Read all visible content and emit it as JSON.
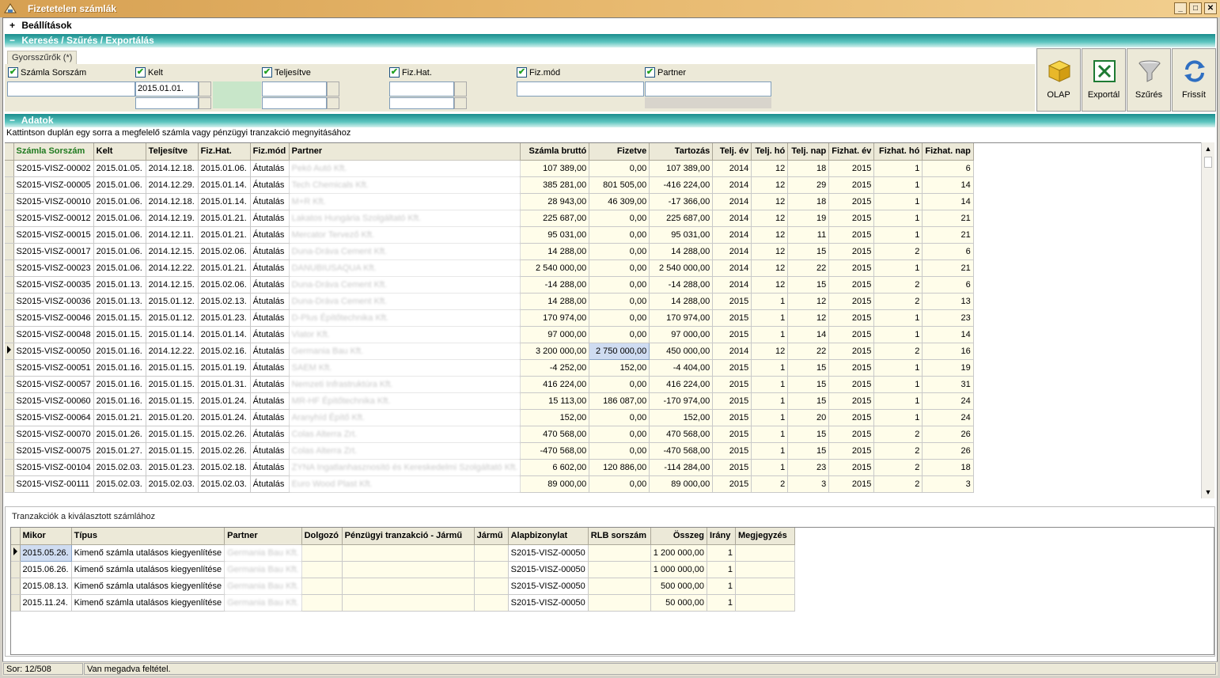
{
  "window": {
    "title": "Fizetetelen számlák",
    "controls": [
      "_",
      "□",
      "✕"
    ]
  },
  "sections": {
    "settings": "Beállítások",
    "search": "Keresés / Szűrés / Exportálás",
    "data": "Adatok",
    "settings_sign": "+",
    "search_sign": "−",
    "data_sign": "−"
  },
  "quick_filters_tab": "Gyorsszűrők (*)",
  "filters": [
    {
      "label": "Számla Sorszám",
      "value": ""
    },
    {
      "label": "Kelt",
      "value": "2015.01.01."
    },
    {
      "label": "Teljesítve",
      "value": ""
    },
    {
      "label": "Fiz.Hat.",
      "value": ""
    },
    {
      "label": "Fiz.mód",
      "value": ""
    },
    {
      "label": "Partner",
      "value": ""
    }
  ],
  "toolbar": [
    {
      "label": "OLAP",
      "icon": "olap-cube-icon"
    },
    {
      "label": "Exportál",
      "icon": "excel-export-icon"
    },
    {
      "label": "Szűrés",
      "icon": "filter-funnel-icon"
    },
    {
      "label": "Frissít",
      "icon": "refresh-icon"
    }
  ],
  "hint": "Kattintson duplán egy sorra a megfelelő számla vagy pénzügyi tranzakció megnyitásához",
  "grid": {
    "columns": [
      "Számla Sorszám",
      "Kelt",
      "Teljesítve",
      "Fiz.Hat.",
      "Fiz.mód",
      "Partner",
      "Számla bruttó",
      "Fizetve",
      "Tartozás",
      "Telj. év",
      "Telj. hó",
      "Telj. nap",
      "Fizhat. év",
      "Fizhat. hó",
      "Fizhat. nap"
    ],
    "rows": [
      [
        "S2015-VISZ-00002",
        "2015.01.05.",
        "2014.12.18.",
        "2015.01.06.",
        "Átutalás",
        "Pekó Autó Kft.",
        "107 389,00",
        "0,00",
        "107 389,00",
        "2014",
        "12",
        "18",
        "2015",
        "1",
        "6"
      ],
      [
        "S2015-VISZ-00005",
        "2015.01.06.",
        "2014.12.29.",
        "2015.01.14.",
        "Átutalás",
        "Tech Chemicals Kft.",
        "385 281,00",
        "801 505,00",
        "-416 224,00",
        "2014",
        "12",
        "29",
        "2015",
        "1",
        "14"
      ],
      [
        "S2015-VISZ-00010",
        "2015.01.06.",
        "2014.12.18.",
        "2015.01.14.",
        "Átutalás",
        "M+R Kft.",
        "28 943,00",
        "46 309,00",
        "-17 366,00",
        "2014",
        "12",
        "18",
        "2015",
        "1",
        "14"
      ],
      [
        "S2015-VISZ-00012",
        "2015.01.06.",
        "2014.12.19.",
        "2015.01.21.",
        "Átutalás",
        "Lakatos Hungária Szolgáltató Kft.",
        "225 687,00",
        "0,00",
        "225 687,00",
        "2014",
        "12",
        "19",
        "2015",
        "1",
        "21"
      ],
      [
        "S2015-VISZ-00015",
        "2015.01.06.",
        "2014.12.11.",
        "2015.01.21.",
        "Átutalás",
        "Mercator Tervező Kft.",
        "95 031,00",
        "0,00",
        "95 031,00",
        "2014",
        "12",
        "11",
        "2015",
        "1",
        "21"
      ],
      [
        "S2015-VISZ-00017",
        "2015.01.06.",
        "2014.12.15.",
        "2015.02.06.",
        "Átutalás",
        "Duna-Dráva Cement Kft.",
        "14 288,00",
        "0,00",
        "14 288,00",
        "2014",
        "12",
        "15",
        "2015",
        "2",
        "6"
      ],
      [
        "S2015-VISZ-00023",
        "2015.01.06.",
        "2014.12.22.",
        "2015.01.21.",
        "Átutalás",
        "DANUBIUSAQUA Kft.",
        "2 540 000,00",
        "0,00",
        "2 540 000,00",
        "2014",
        "12",
        "22",
        "2015",
        "1",
        "21"
      ],
      [
        "S2015-VISZ-00035",
        "2015.01.13.",
        "2014.12.15.",
        "2015.02.06.",
        "Átutalás",
        "Duna-Dráva Cement Kft.",
        "-14 288,00",
        "0,00",
        "-14 288,00",
        "2014",
        "12",
        "15",
        "2015",
        "2",
        "6"
      ],
      [
        "S2015-VISZ-00036",
        "2015.01.13.",
        "2015.01.12.",
        "2015.02.13.",
        "Átutalás",
        "Duna-Dráva Cement Kft.",
        "14 288,00",
        "0,00",
        "14 288,00",
        "2015",
        "1",
        "12",
        "2015",
        "2",
        "13"
      ],
      [
        "S2015-VISZ-00046",
        "2015.01.15.",
        "2015.01.12.",
        "2015.01.23.",
        "Átutalás",
        "D-Plus Építőtechnika Kft.",
        "170 974,00",
        "0,00",
        "170 974,00",
        "2015",
        "1",
        "12",
        "2015",
        "1",
        "23"
      ],
      [
        "S2015-VISZ-00048",
        "2015.01.15.",
        "2015.01.14.",
        "2015.01.14.",
        "Átutalás",
        "Viator Kft.",
        "97 000,00",
        "0,00",
        "97 000,00",
        "2015",
        "1",
        "14",
        "2015",
        "1",
        "14"
      ],
      [
        "S2015-VISZ-00050",
        "2015.01.16.",
        "2014.12.22.",
        "2015.02.16.",
        "Átutalás",
        "Germania Bau Kft.",
        "3 200 000,00",
        "2 750 000,00",
        "450 000,00",
        "2014",
        "12",
        "22",
        "2015",
        "2",
        "16"
      ],
      [
        "S2015-VISZ-00051",
        "2015.01.16.",
        "2015.01.15.",
        "2015.01.19.",
        "Átutalás",
        "SAEM Kft.",
        "-4 252,00",
        "152,00",
        "-4 404,00",
        "2015",
        "1",
        "15",
        "2015",
        "1",
        "19"
      ],
      [
        "S2015-VISZ-00057",
        "2015.01.16.",
        "2015.01.15.",
        "2015.01.31.",
        "Átutalás",
        "Nemzeti Infrastruktúra Kft.",
        "416 224,00",
        "0,00",
        "416 224,00",
        "2015",
        "1",
        "15",
        "2015",
        "1",
        "31"
      ],
      [
        "S2015-VISZ-00060",
        "2015.01.16.",
        "2015.01.15.",
        "2015.01.24.",
        "Átutalás",
        "MR-HF Építőtechnika Kft.",
        "15 113,00",
        "186 087,00",
        "-170 974,00",
        "2015",
        "1",
        "15",
        "2015",
        "1",
        "24"
      ],
      [
        "S2015-VISZ-00064",
        "2015.01.21.",
        "2015.01.20.",
        "2015.01.24.",
        "Átutalás",
        "Aranyhíd Építő Kft.",
        "152,00",
        "0,00",
        "152,00",
        "2015",
        "1",
        "20",
        "2015",
        "1",
        "24"
      ],
      [
        "S2015-VISZ-00070",
        "2015.01.26.",
        "2015.01.15.",
        "2015.02.26.",
        "Átutalás",
        "Colas Alterra Zrt.",
        "470 568,00",
        "0,00",
        "470 568,00",
        "2015",
        "1",
        "15",
        "2015",
        "2",
        "26"
      ],
      [
        "S2015-VISZ-00075",
        "2015.01.27.",
        "2015.01.15.",
        "2015.02.26.",
        "Átutalás",
        "Colas Alterra Zrt.",
        "-470 568,00",
        "0,00",
        "-470 568,00",
        "2015",
        "1",
        "15",
        "2015",
        "2",
        "26"
      ],
      [
        "S2015-VISZ-00104",
        "2015.02.03.",
        "2015.01.23.",
        "2015.02.18.",
        "Átutalás",
        "ZYNA Ingatlanhasznosító és Kereskedelmi Szolgáltató Kft.",
        "6 602,00",
        "120 886,00",
        "-114 284,00",
        "2015",
        "1",
        "23",
        "2015",
        "2",
        "18"
      ],
      [
        "S2015-VISZ-00111",
        "2015.02.03.",
        "2015.02.03.",
        "2015.02.03.",
        "Átutalás",
        "Euro Wood Plast Kft.",
        "89 000,00",
        "0,00",
        "89 000,00",
        "2015",
        "2",
        "3",
        "2015",
        "2",
        "3"
      ]
    ]
  },
  "transactions": {
    "title": "Tranzakciók a kiválasztott számlához",
    "columns": [
      "Mikor",
      "Típus",
      "Partner",
      "Dolgozó",
      "Pénzügyi tranzakció - Jármű",
      "Jármű",
      "Alapbizonylat",
      "RLB sorszám",
      "Összeg",
      "Irány",
      "Megjegyzés"
    ],
    "rows": [
      [
        "2015.05.26.",
        "Kimenő számla utalásos kiegyenlítése",
        "Germania Bau Kft.",
        "",
        "",
        "",
        "S2015-VISZ-00050",
        "",
        "1 200 000,00",
        "1",
        ""
      ],
      [
        "2015.06.26.",
        "Kimenő számla utalásos kiegyenlítése",
        "Germania Bau Kft.",
        "",
        "",
        "",
        "S2015-VISZ-00050",
        "",
        "1 000 000,00",
        "1",
        ""
      ],
      [
        "2015.08.13.",
        "Kimenő számla utalásos kiegyenlítése",
        "Germania Bau Kft.",
        "",
        "",
        "",
        "S2015-VISZ-00050",
        "",
        "500 000,00",
        "1",
        ""
      ],
      [
        "2015.11.24.",
        "Kimenő számla utalásos kiegyenlítése",
        "Germania Bau Kft.",
        "",
        "",
        "",
        "S2015-VISZ-00050",
        "",
        "50 000,00",
        "1",
        ""
      ]
    ]
  },
  "status": {
    "row": "Sor: 12/508",
    "message": "Van megadva feltétel."
  },
  "colors": {
    "section_teal": "#1a8d8d",
    "title_orange": "#d6a052",
    "row_yellow": "#fffdea",
    "selected_cell": "#cfdcf1"
  }
}
